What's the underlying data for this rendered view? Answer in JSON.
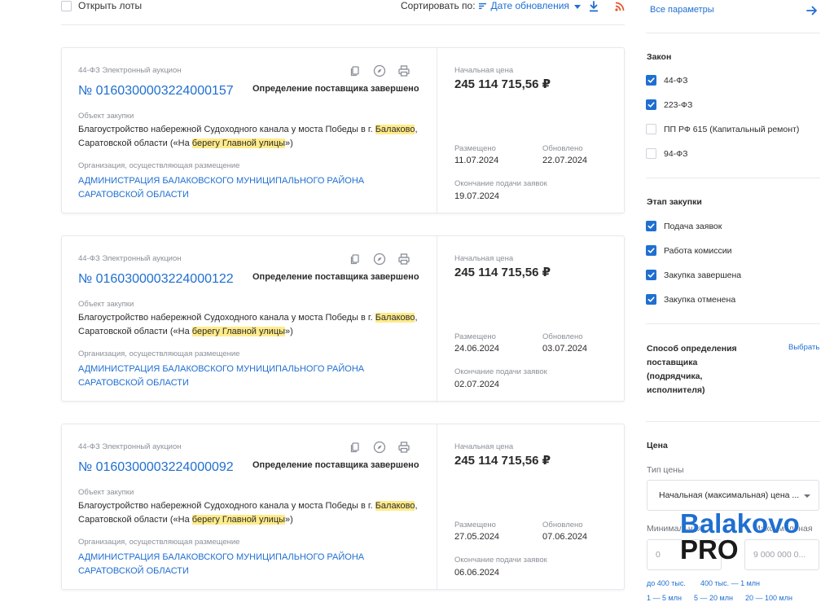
{
  "toolbar": {
    "open_lots": "Открыть лоты",
    "sort_label": "Сортировать по:",
    "sort_value": "Дате обновления"
  },
  "cards": [
    {
      "type": "44-ФЗ Электронный аукцион",
      "number": "№ 0160300003224000157",
      "status": "Определение поставщика завершено",
      "object_label": "Объект закупки",
      "object_parts": [
        "Благоустройство набережной Судоходного канала у моста Победы в г. ",
        "Балаково",
        ", Саратовской области («На ",
        "берегу Главной улицы",
        "»)"
      ],
      "org_label": "Организация, осуществляющая размещение",
      "org": "АДМИНИСТРАЦИЯ БАЛАКОВСКОГО МУНИЦИПАЛЬНОГО РАЙОНА САРАТОВСКОЙ ОБЛАСТИ",
      "price_label": "Начальная цена",
      "price": "245 114 715,56 ₽",
      "placed_label": "Размещено",
      "placed": "11.07.2024",
      "updated_label": "Обновлено",
      "updated": "22.07.2024",
      "end_label": "Окончание подачи заявок",
      "end": "19.07.2024"
    },
    {
      "type": "44-ФЗ Электронный аукцион",
      "number": "№ 0160300003224000122",
      "status": "Определение поставщика завершено",
      "object_label": "Объект закупки",
      "object_parts": [
        "Благоустройство набережной Судоходного канала у моста Победы в г. ",
        "Балаково",
        ", Саратовской области («На ",
        "берегу Главной улицы",
        "»)"
      ],
      "org_label": "Организация, осуществляющая размещение",
      "org": "АДМИНИСТРАЦИЯ БАЛАКОВСКОГО МУНИЦИПАЛЬНОГО РАЙОНА САРАТОВСКОЙ ОБЛАСТИ",
      "price_label": "Начальная цена",
      "price": "245 114 715,56 ₽",
      "placed_label": "Размещено",
      "placed": "24.06.2024",
      "updated_label": "Обновлено",
      "updated": "03.07.2024",
      "end_label": "Окончание подачи заявок",
      "end": "02.07.2024"
    },
    {
      "type": "44-ФЗ Электронный аукцион",
      "number": "№ 0160300003224000092",
      "status": "Определение поставщика завершено",
      "object_label": "Объект закупки",
      "object_parts": [
        "Благоустройство набережной Судоходного канала у моста Победы в г. ",
        "Балаково",
        ", Саратовской области («На ",
        "берегу Главной улицы",
        "»)"
      ],
      "org_label": "Организация, осуществляющая размещение",
      "org": "АДМИНИСТРАЦИЯ БАЛАКОВСКОГО МУНИЦИПАЛЬНОГО РАЙОНА САРАТОВСКОЙ ОБЛАСТИ",
      "price_label": "Начальная цена",
      "price": "245 114 715,56 ₽",
      "placed_label": "Размещено",
      "placed": "27.05.2024",
      "updated_label": "Обновлено",
      "updated": "07.06.2024",
      "end_label": "Окончание подачи заявок",
      "end": "06.06.2024"
    }
  ],
  "sidebar": {
    "all_params": "Все параметры",
    "law_title": "Закон",
    "laws": [
      {
        "label": "44-ФЗ",
        "checked": true
      },
      {
        "label": "223-ФЗ",
        "checked": true
      },
      {
        "label": "ПП РФ 615 (Капитальный ремонт)",
        "checked": false
      },
      {
        "label": "94-ФЗ",
        "checked": false
      }
    ],
    "stage_title": "Этап закупки",
    "stages": [
      {
        "label": "Подача заявок",
        "checked": true
      },
      {
        "label": "Работа комиссии",
        "checked": true
      },
      {
        "label": "Закупка завершена",
        "checked": true
      },
      {
        "label": "Закупка отменена",
        "checked": true
      }
    ],
    "method_title": "Способ определения поставщика (подрядчика, исполнителя)",
    "method_choose": "Выбрать",
    "price_title": "Цена",
    "price_type_label": "Тип цены",
    "price_type_value": "Начальная (максимальная) цена ...",
    "min_label": "Минимальная",
    "max_label": "Максимальная",
    "min_placeholder": "0",
    "max_placeholder": "9 000 000 0...",
    "quick_ranges": [
      "до 400 тыс.",
      "400 тыс. — 1 млн",
      "1 — 5 млн",
      "5 — 20 млн",
      "20 — 100 млн"
    ]
  },
  "watermark": {
    "line1": "Balakovo",
    "line2": "PRO"
  },
  "colors": {
    "accent": "#1f6fd1",
    "highlight": "#ffeb8a",
    "border": "#e6e9ee"
  }
}
